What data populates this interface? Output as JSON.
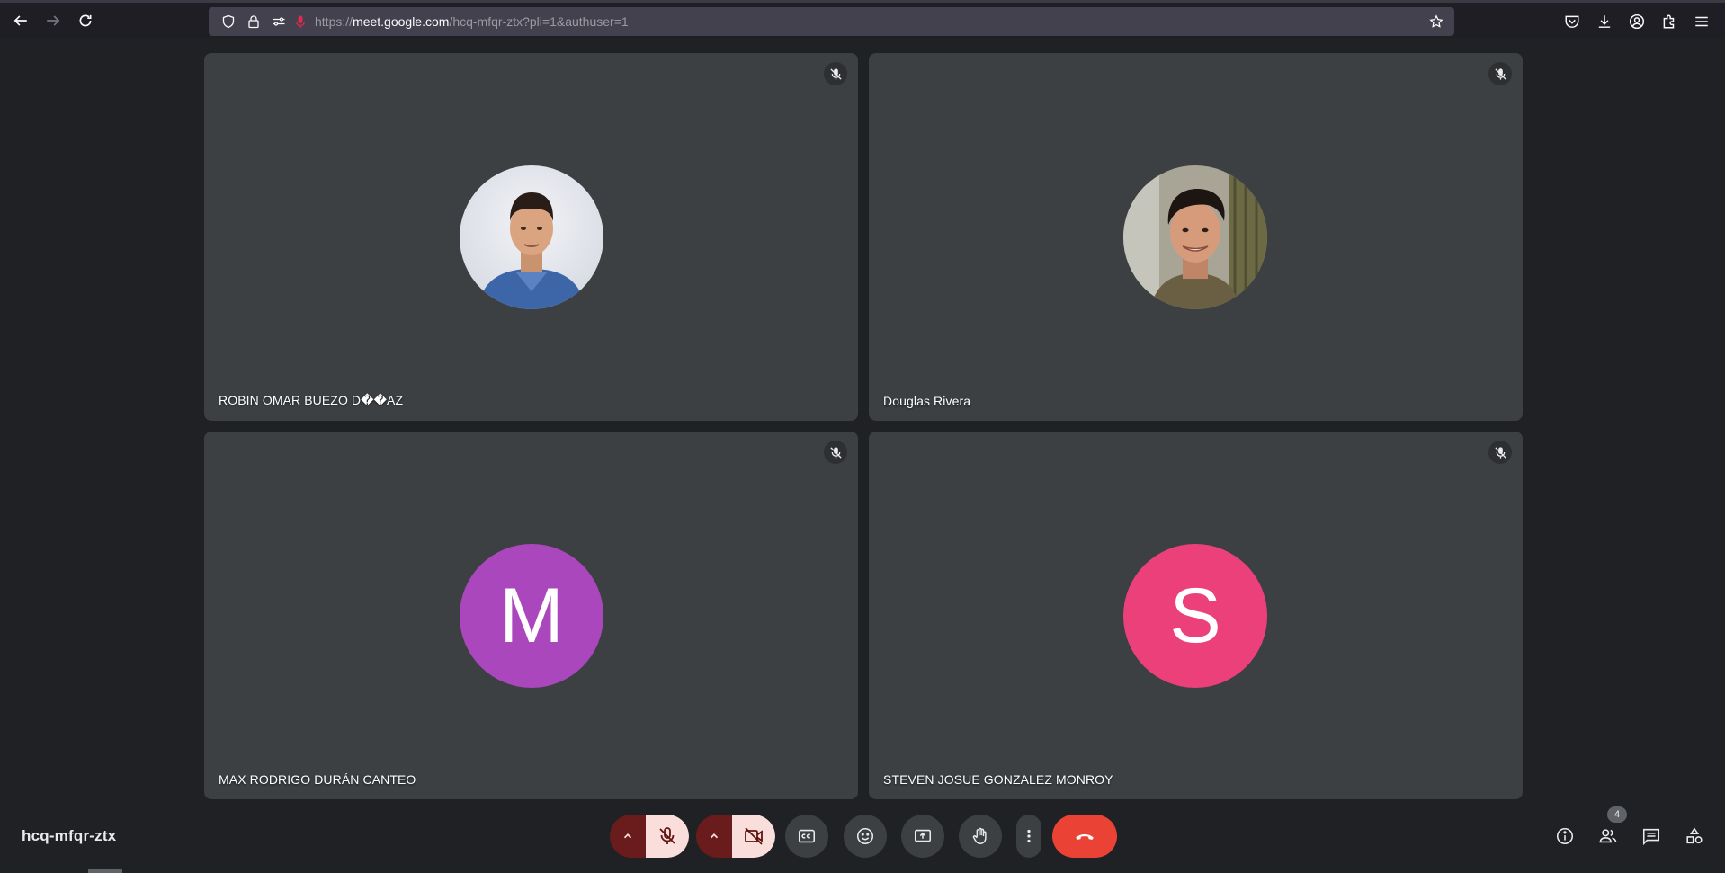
{
  "browser": {
    "url_prefix": "https://",
    "url_host": "meet.google.com",
    "url_path": "/hcq-mfqr-ztx?pli=1&authuser=1"
  },
  "participants": [
    {
      "name": "ROBIN OMAR BUEZO D��AZ",
      "avatar": "photo",
      "muted": true
    },
    {
      "name": "Douglas Rivera",
      "avatar": "photo",
      "muted": true
    },
    {
      "name": "MAX RODRIGO DURÁN CANTEO",
      "avatar_letter": "M",
      "avatar_color": "#ab47bc",
      "muted": true
    },
    {
      "name": "STEVEN JOSUE GONZALEZ MONROY",
      "avatar_letter": "S",
      "avatar_color": "#ec407a",
      "muted": true
    }
  ],
  "meeting": {
    "code": "hcq-mfqr-ztx",
    "participant_count": "4"
  },
  "colors": {
    "background": "#202124",
    "tile": "#3c4043",
    "hangup": "#ea4335",
    "mic_off_bg": "#f9dedc"
  }
}
